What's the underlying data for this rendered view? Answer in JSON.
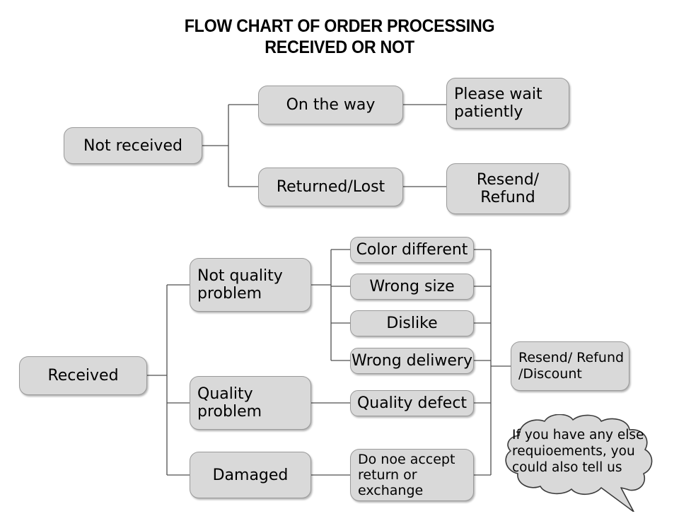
{
  "title": "FLOW CHART OF ORDER PROCESSING\nRECEIVED OR NOT",
  "colors": {
    "node_fill": "#d9d9d9",
    "node_border": "#9a9a9a",
    "connector": "#4f4f4f",
    "text": "#000000",
    "background": "#ffffff"
  },
  "chart_data": {
    "type": "diagram",
    "diagram_kind": "flowchart-tree",
    "title": "FLOW CHART OF ORDER PROCESSING RECEIVED OR NOT",
    "branches": [
      {
        "root": "Not received",
        "children": [
          {
            "label": "On the way",
            "outcome": "Please wait patiently"
          },
          {
            "label": "Returned/Lost",
            "outcome": "Resend/\nRefund"
          }
        ]
      },
      {
        "root": "Received",
        "children": [
          {
            "label": "Not quality\nproblem",
            "reasons": [
              "Color different",
              "Wrong size",
              "Dislike",
              "Wrong deliwery"
            ],
            "outcome": "Resend/ Refund\n/Discount"
          },
          {
            "label": "Quality\nproblem",
            "reasons": [
              "Quality defect"
            ],
            "outcome": "Resend/ Refund\n/Discount"
          },
          {
            "label": "Damaged",
            "reasons": [
              "Do noe accept\nreturn or\nexchange"
            ],
            "outcome": null
          }
        ]
      }
    ],
    "note": "If you have any else\nrequioements, you\ncould also tell us"
  },
  "nodes": {
    "not_received": "Not received",
    "on_the_way": "On the way",
    "returned_lost": "Returned/Lost",
    "please_wait": "Please wait\npatiently",
    "resend_refund": "Resend/\nRefund",
    "received": "Received",
    "not_quality_problem": "Not quality\nproblem",
    "quality_problem": "Quality\nproblem",
    "damaged": "Damaged",
    "color_different": "Color different",
    "wrong_size": "Wrong size",
    "dislike": "Dislike",
    "wrong_deliwery": "Wrong deliwery",
    "quality_defect": "Quality defect",
    "do_not_accept": "Do noe accept\nreturn or\nexchange",
    "resend_refund_discount": "Resend/ Refund\n/Discount"
  },
  "bubble": {
    "text": "If you have any else\nrequioements, you\ncould also tell us"
  }
}
